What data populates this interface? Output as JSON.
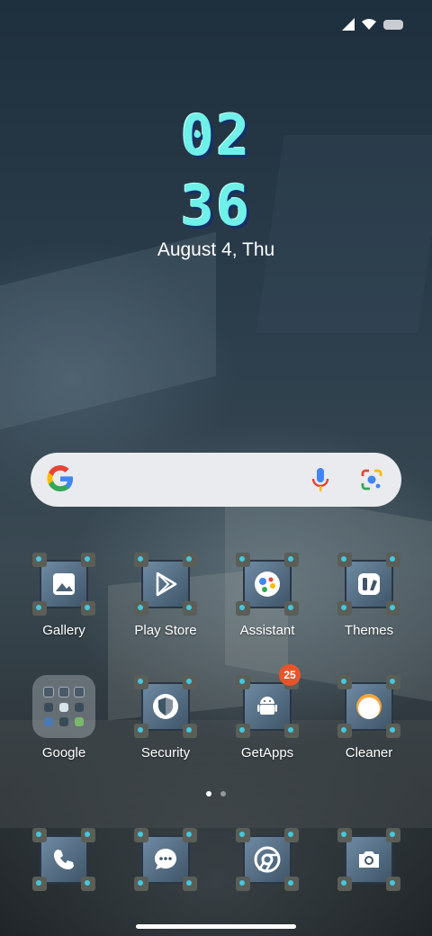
{
  "clock": {
    "hour": "02",
    "minute": "36",
    "date": "August 4, Thu"
  },
  "search": {
    "engine": "Google"
  },
  "apps": [
    {
      "name": "Gallery",
      "icon": "gallery-icon"
    },
    {
      "name": "Play Store",
      "icon": "play-store-icon"
    },
    {
      "name": "Assistant",
      "icon": "assistant-icon"
    },
    {
      "name": "Themes",
      "icon": "themes-icon"
    },
    {
      "name": "Google",
      "icon": "folder-icon"
    },
    {
      "name": "Security",
      "icon": "shield-icon"
    },
    {
      "name": "GetApps",
      "icon": "android-icon",
      "badge": "25"
    },
    {
      "name": "Cleaner",
      "icon": "cleaner-icon"
    }
  ],
  "dock": [
    {
      "icon": "phone-icon"
    },
    {
      "icon": "messages-icon"
    },
    {
      "icon": "chrome-icon"
    },
    {
      "icon": "camera-icon"
    }
  ],
  "pages": {
    "current": 1,
    "total": 2
  },
  "colors": {
    "clock": "#6ff0e8",
    "badge": "#e8542a",
    "search_bg": "#e9ebee"
  }
}
